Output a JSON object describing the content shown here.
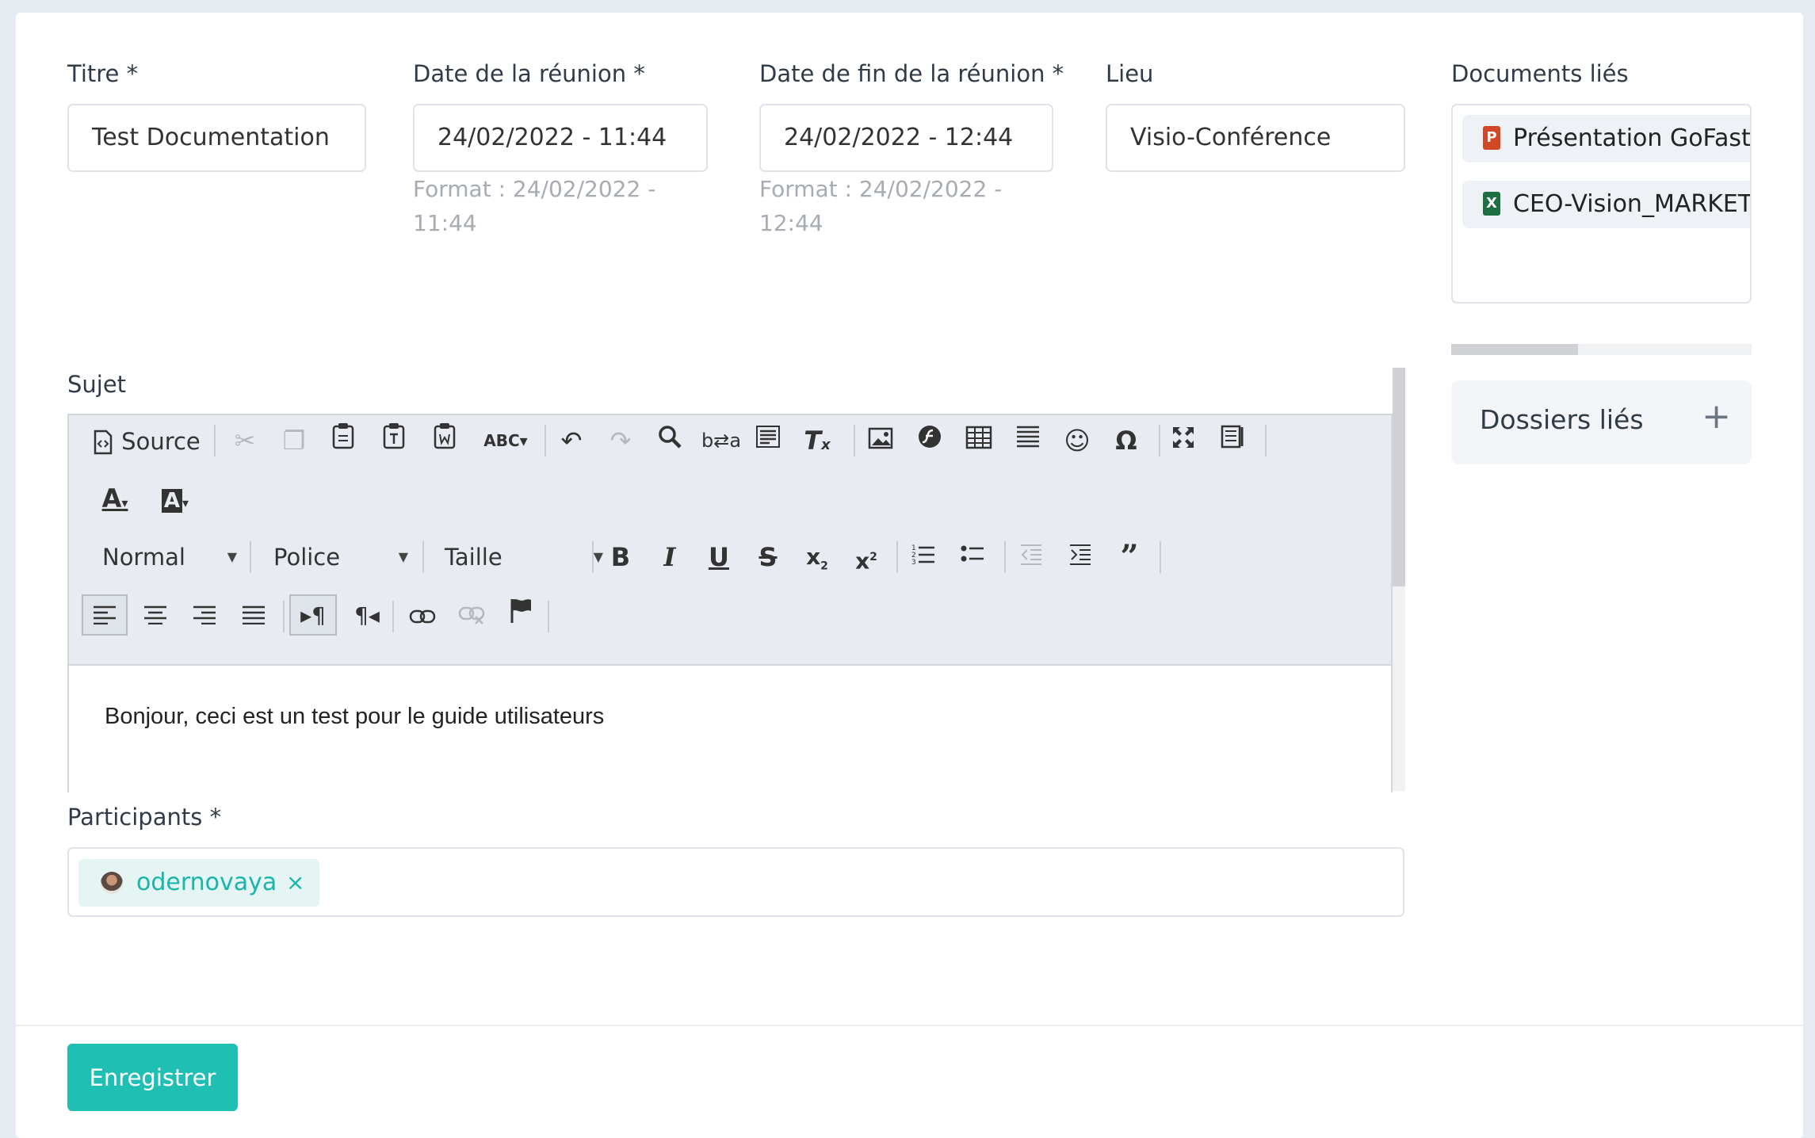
{
  "form": {
    "title": {
      "label": "Titre *",
      "value": "Test Documentation"
    },
    "start_date": {
      "label": "Date de la réunion *",
      "value": "24/02/2022 - 11:44",
      "hint": "Format : 24/02/2022 - 11:44"
    },
    "end_date": {
      "label": "Date de fin de la réunion *",
      "value": "24/02/2022 - 12:44",
      "hint": "Format : 24/02/2022 - 12:44"
    },
    "location": {
      "label": "Lieu",
      "value": "Visio-Conférence"
    },
    "subject": {
      "label": "Sujet",
      "content": "Bonjour, ceci est un test pour le guide utilisateurs"
    },
    "participants": {
      "label": "Participants *",
      "items": [
        {
          "name": "odernovaya",
          "remove": "×"
        }
      ]
    }
  },
  "toolbar": {
    "source_label": "Source",
    "format_label": "Normal",
    "font_label": "Police",
    "size_label": "Taille",
    "icons": {
      "cut": "scissors-icon",
      "copy": "copy-icon",
      "paste": "paste-icon",
      "paste_text": "paste-text-icon",
      "paste_word": "paste-word-icon",
      "spellcheck": "spellcheck-icon",
      "undo": "undo-icon",
      "redo": "redo-icon",
      "find": "search-icon",
      "replace": "replace-icon",
      "select_all": "select-all-icon",
      "remove_format": "remove-format-icon",
      "image": "image-icon",
      "flash": "flash-icon",
      "table": "table-icon",
      "hr": "horizontal-rule-icon",
      "smiley": "smiley-icon",
      "special_char": "omega-icon",
      "maximize": "maximize-icon",
      "show_blocks": "show-blocks-icon",
      "text_color": "text-color-icon",
      "bg_color": "background-color-icon",
      "bold": "bold-icon",
      "italic": "italic-icon",
      "underline": "underline-icon",
      "strike": "strikethrough-icon",
      "subscript": "subscript-icon",
      "superscript": "superscript-icon",
      "ordered_list": "ordered-list-icon",
      "bullet_list": "bullet-list-icon",
      "outdent": "outdent-icon",
      "indent": "indent-icon",
      "blockquote": "blockquote-icon",
      "align_left": "align-left-icon",
      "align_center": "align-center-icon",
      "align_right": "align-right-icon",
      "justify": "justify-icon",
      "ltr": "ltr-icon",
      "rtl": "rtl-icon",
      "link": "link-icon",
      "unlink": "unlink-icon",
      "anchor": "anchor-flag-icon"
    }
  },
  "sidebar": {
    "documents_label": "Documents liés",
    "documents": [
      {
        "name": "Présentation GoFast A",
        "type": "powerpoint",
        "badge": "P",
        "color": "#d24726"
      },
      {
        "name": "CEO-Vision_MARKETIN",
        "type": "excel",
        "badge": "X",
        "color": "#1d6f42"
      }
    ],
    "folders_label": "Dossiers liés",
    "folders_add": "+"
  },
  "actions": {
    "save_label": "Enregistrer"
  },
  "colors": {
    "accent": "#1fbfb3",
    "chip_bg": "#e4f5f4",
    "toolbar_bg": "#e8ebf1"
  }
}
